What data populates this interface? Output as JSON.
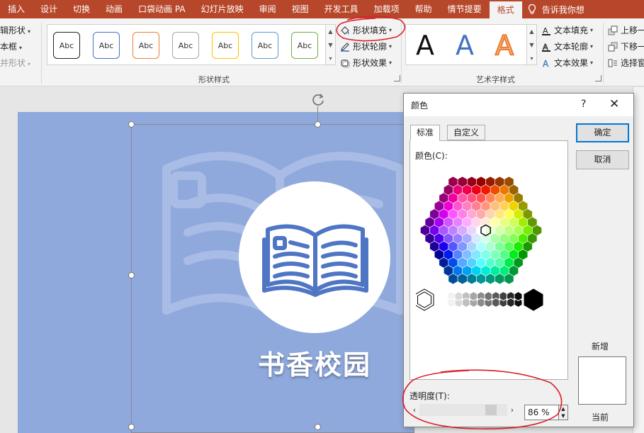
{
  "tabs": [
    "插入",
    "设计",
    "切换",
    "动画",
    "口袋动画 PA",
    "幻灯片放映",
    "审阅",
    "视图",
    "开发工具",
    "加载项",
    "帮助",
    "情节提要",
    "格式"
  ],
  "active_tab": "格式",
  "tell_me": "告诉我你想",
  "left_group": {
    "edit_shape": "辑形状",
    "text_box": "本框",
    "merge_shapes": "并形状"
  },
  "shape_styles": {
    "swatch_text": "Abc",
    "group_label": "形状样式",
    "fill": "形状填充",
    "outline": "形状轮廓",
    "effects": "形状效果",
    "swatch_colors": [
      "#222222",
      "#4472c4",
      "#ed7d31",
      "#a5a5a5",
      "#ffc000",
      "#5b9bd5",
      "#70ad47"
    ]
  },
  "wordart": {
    "letter": "A",
    "group_label": "艺术字样式",
    "text_fill": "文本填充",
    "text_outline": "文本轮廓",
    "text_effects": "文本效果"
  },
  "arrange": {
    "bring_forward": "上移一",
    "send_backward": "下移一",
    "selection_pane": "选择窗"
  },
  "slide": {
    "title": "书香校园",
    "bg_color": "#8fa9dc",
    "icon_color": "#4f76c4"
  },
  "dialog": {
    "title": "颜色",
    "help": "?",
    "close": "✕",
    "tab_standard": "标准",
    "tab_custom": "自定义",
    "colors_label": "颜色(C):",
    "ok": "确定",
    "cancel": "取消",
    "new_label": "新增",
    "current_label": "当前",
    "transparency_label": "透明度(T):",
    "transparency_value": "86 %",
    "transparency": 0.86
  },
  "accent_red": "#d9202a"
}
